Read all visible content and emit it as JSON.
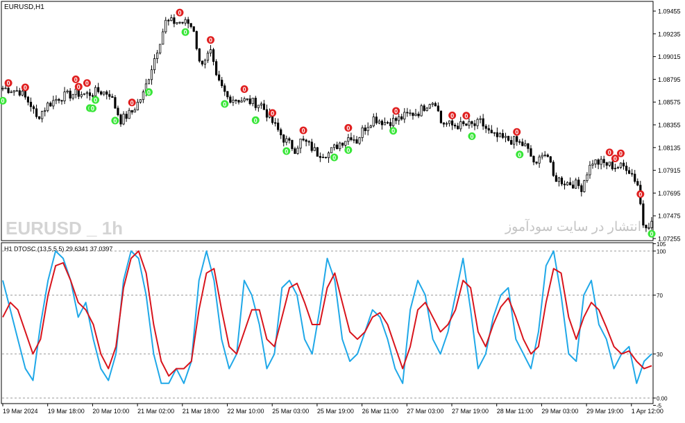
{
  "main_panel": {
    "symbol_label": "EURUSD,H1",
    "watermark_symbol": "EURUSD _ 1h",
    "watermark_site": "انتشار در سایت سودآموز",
    "price_axis": [
      "1.09455",
      "1.09235",
      "1.09015",
      "1.08795",
      "1.08575",
      "1.08355",
      "1.08135",
      "1.07915",
      "1.07695",
      "1.07475",
      "1.07255"
    ]
  },
  "sub_panel": {
    "indicator_label": "H1 DTOSC (13,5,5,5) 29.6341 37.0397",
    "axis": [
      "105",
      "100",
      "70",
      "30",
      "0.00",
      "-5"
    ]
  },
  "time_axis": [
    "19 Mar 2024",
    "19 Mar 18:00",
    "20 Mar 10:00",
    "21 Mar 02:00",
    "21 Mar 18:00",
    "22 Mar 10:00",
    "25 Mar 03:00",
    "25 Mar 19:00",
    "26 Mar 11:00",
    "27 Mar 03:00",
    "27 Mar 19:00",
    "28 Mar 11:00",
    "29 Mar 03:00",
    "29 Mar 19:00",
    "1 Apr 12:00"
  ],
  "chart_data": [
    {
      "type": "candlestick",
      "title": "EURUSD,H1",
      "ylim": [
        1.0715,
        1.0956
      ],
      "close_path": [
        [
          0,
          1.0871
        ],
        [
          6,
          1.0868
        ],
        [
          10,
          1.0855
        ],
        [
          12,
          1.0842
        ],
        [
          16,
          1.0855
        ],
        [
          20,
          1.0862
        ],
        [
          26,
          1.0866
        ],
        [
          30,
          1.0865
        ],
        [
          34,
          1.0868
        ],
        [
          38,
          1.0866
        ],
        [
          42,
          1.084
        ],
        [
          46,
          1.0848
        ],
        [
          50,
          1.0865
        ],
        [
          54,
          1.09
        ],
        [
          58,
          1.0935
        ],
        [
          62,
          1.0935
        ],
        [
          66,
          1.0934
        ],
        [
          68,
          1.0928
        ],
        [
          70,
          1.0895
        ],
        [
          74,
          1.0905
        ],
        [
          76,
          1.088
        ],
        [
          80,
          1.0862
        ],
        [
          84,
          1.086
        ],
        [
          88,
          1.0858
        ],
        [
          92,
          1.0855
        ],
        [
          96,
          1.0838
        ],
        [
          100,
          1.0822
        ],
        [
          104,
          1.0812
        ],
        [
          106,
          1.082
        ],
        [
          108,
          1.0818
        ],
        [
          112,
          1.0808
        ],
        [
          116,
          1.0808
        ],
        [
          120,
          1.0818
        ],
        [
          124,
          1.0825
        ],
        [
          126,
          1.082
        ],
        [
          128,
          1.083
        ],
        [
          132,
          1.0842
        ],
        [
          136,
          1.0838
        ],
        [
          140,
          1.084
        ],
        [
          144,
          1.0845
        ],
        [
          148,
          1.0848
        ],
        [
          152,
          1.0858
        ],
        [
          154,
          1.0858
        ],
        [
          156,
          1.0838
        ],
        [
          160,
          1.0835
        ],
        [
          164,
          1.0835
        ],
        [
          168,
          1.0835
        ],
        [
          170,
          1.0838
        ],
        [
          172,
          1.0832
        ],
        [
          174,
          1.0825
        ],
        [
          178,
          1.0822
        ],
        [
          182,
          1.082
        ],
        [
          186,
          1.0815
        ],
        [
          190,
          1.0795
        ],
        [
          192,
          1.081
        ],
        [
          194,
          1.0805
        ],
        [
          196,
          1.0785
        ],
        [
          200,
          1.078
        ],
        [
          204,
          1.0778
        ],
        [
          206,
          1.0775
        ],
        [
          208,
          1.079
        ],
        [
          210,
          1.08
        ],
        [
          214,
          1.0798
        ],
        [
          218,
          1.0795
        ],
        [
          222,
          1.0795
        ],
        [
          224,
          1.0788
        ],
        [
          226,
          1.0778
        ],
        [
          228,
          1.074
        ],
        [
          230,
          1.074
        ]
      ],
      "signals": [
        {
          "type": "up",
          "label": "0",
          "at": [
            0,
            31,
            32,
            33,
            40,
            52,
            65,
            79,
            90,
            101,
            118,
            123,
            139,
            167,
            184,
            231
          ]
        },
        {
          "type": "down",
          "label": "0",
          "at": [
            2,
            8,
            26,
            27,
            30,
            46,
            63,
            74,
            86,
            96,
            107,
            123,
            140,
            160,
            165,
            183,
            216,
            218,
            220,
            227
          ]
        }
      ]
    },
    {
      "type": "line",
      "title": "H1 DTOSC (13,5,5,5) 29.6341 37.0397",
      "ylim": [
        -5,
        105
      ],
      "levels": [
        30,
        70
      ],
      "series": [
        {
          "name": "29.6341",
          "color": "#1FA8E8",
          "values": [
            80,
            60,
            40,
            20,
            12,
            50,
            80,
            100,
            95,
            80,
            55,
            65,
            40,
            20,
            12,
            30,
            80,
            100,
            95,
            70,
            30,
            10,
            10,
            20,
            10,
            25,
            80,
            100,
            80,
            40,
            20,
            30,
            80,
            70,
            50,
            20,
            30,
            75,
            80,
            70,
            40,
            30,
            60,
            95,
            80,
            40,
            25,
            30,
            45,
            60,
            55,
            40,
            20,
            10,
            60,
            80,
            70,
            40,
            30,
            45,
            70,
            95,
            60,
            20,
            30,
            55,
            70,
            75,
            40,
            30,
            20,
            45,
            90,
            100,
            70,
            30,
            25,
            70,
            80,
            50,
            40,
            20,
            30,
            35,
            10,
            25,
            30
          ]
        },
        {
          "name": "37.0397",
          "color": "#D8141C",
          "values": [
            55,
            65,
            60,
            45,
            30,
            40,
            70,
            90,
            92,
            80,
            65,
            60,
            50,
            30,
            20,
            35,
            75,
            95,
            100,
            85,
            50,
            25,
            15,
            20,
            20,
            25,
            60,
            85,
            88,
            60,
            35,
            30,
            45,
            60,
            60,
            40,
            35,
            55,
            75,
            78,
            65,
            50,
            50,
            75,
            85,
            65,
            45,
            40,
            45,
            55,
            58,
            50,
            35,
            20,
            35,
            60,
            65,
            55,
            45,
            50,
            60,
            80,
            75,
            45,
            35,
            50,
            62,
            68,
            55,
            40,
            30,
            35,
            65,
            88,
            85,
            55,
            40,
            55,
            65,
            60,
            48,
            35,
            30,
            32,
            25,
            20,
            22
          ]
        }
      ]
    }
  ]
}
